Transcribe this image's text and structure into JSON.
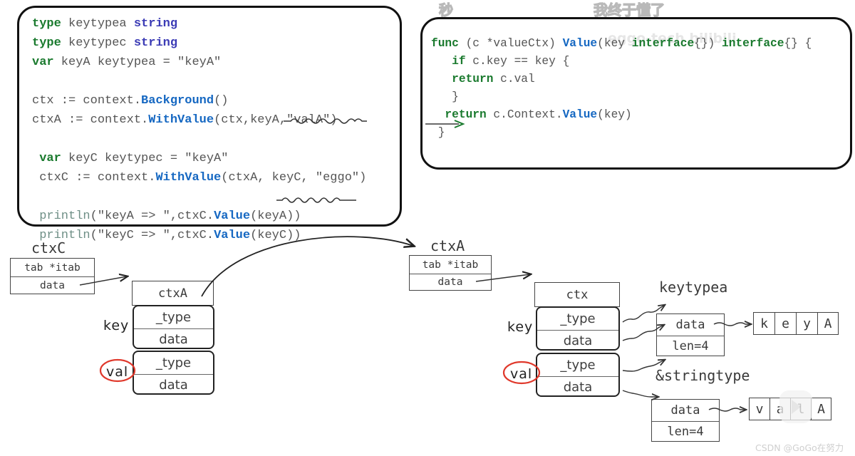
{
  "page": {
    "title": "Go context.WithValue chain memory layout diagram",
    "background": "#ffffff"
  },
  "colors": {
    "keyword_green": "#1a7a2e",
    "type_blue": "#3b3bb5",
    "func_blue": "#1668c2",
    "println_teal": "#6e8f86",
    "code_gray": "#555555",
    "ink_black": "#222222",
    "accent_red": "#e0392c",
    "watermark_gray": "#cfcfcf"
  },
  "top_watermarks": {
    "left_text": "秒",
    "right_text": "我终于懂了"
  },
  "code_left": {
    "lines": [
      [
        {
          "t": "type",
          "c": "kw"
        },
        {
          "t": " keytypea ",
          "c": "pn"
        },
        {
          "t": "string",
          "c": "ty"
        }
      ],
      [
        {
          "t": "type",
          "c": "kw"
        },
        {
          "t": " keytypec ",
          "c": "pn"
        },
        {
          "t": "string",
          "c": "ty"
        }
      ],
      [
        {
          "t": "var",
          "c": "kw"
        },
        {
          "t": " keyA keytypea = \"keyA\"",
          "c": "pn"
        }
      ],
      [
        {
          "t": "",
          "c": "pn"
        }
      ],
      [
        {
          "t": "ctx := context.",
          "c": "pn"
        },
        {
          "t": "Background",
          "c": "fn"
        },
        {
          "t": "()",
          "c": "pn"
        }
      ],
      [
        {
          "t": "ctxA := context.",
          "c": "pn"
        },
        {
          "t": "WithValue",
          "c": "fn"
        },
        {
          "t": "(ctx,keyA,\"valA\")",
          "c": "pn"
        }
      ],
      [
        {
          "t": "",
          "c": "pn"
        }
      ],
      [
        {
          "t": " var",
          "c": "kw"
        },
        {
          "t": " keyC keytypec = \"keyA\"",
          "c": "pn"
        }
      ],
      [
        {
          "t": " ctxC := context.",
          "c": "pn"
        },
        {
          "t": "WithValue",
          "c": "fn"
        },
        {
          "t": "(ctxA, keyC, \"eggo\")",
          "c": "pn"
        }
      ],
      [
        {
          "t": "",
          "c": "pn"
        }
      ],
      [
        {
          "t": " println",
          "c": "pl"
        },
        {
          "t": "(\"keyA => \",ctxC.",
          "c": "pn"
        },
        {
          "t": "Value",
          "c": "fn"
        },
        {
          "t": "(keyA))",
          "c": "pn"
        }
      ],
      [
        {
          "t": " println",
          "c": "pl"
        },
        {
          "t": "(\"keyC => \",ctxC.",
          "c": "pn"
        },
        {
          "t": "Value",
          "c": "fn"
        },
        {
          "t": "(keyC))",
          "c": "pn"
        }
      ]
    ]
  },
  "code_right": {
    "watermark": "eggo-tech bilibili",
    "lines": [
      [
        {
          "t": "func",
          "c": "kw"
        },
        {
          "t": " (c *valueCtx) ",
          "c": "pn"
        },
        {
          "t": "Value",
          "c": "fn"
        },
        {
          "t": "(key ",
          "c": "pn"
        },
        {
          "t": "interface",
          "c": "kw"
        },
        {
          "t": "{}) ",
          "c": "pn"
        },
        {
          "t": "interface",
          "c": "kw"
        },
        {
          "t": "{} {",
          "c": "pn"
        }
      ],
      [
        {
          "t": "   if",
          "c": "kw"
        },
        {
          "t": " c.key == key {",
          "c": "pn"
        }
      ],
      [
        {
          "t": "   return",
          "c": "kw"
        },
        {
          "t": " c.val",
          "c": "pn"
        }
      ],
      [
        {
          "t": "   }",
          "c": "pn"
        }
      ],
      [
        {
          "t": "  return",
          "c": "kw"
        },
        {
          "t": " c.Context.",
          "c": "pn"
        },
        {
          "t": "Value",
          "c": "fn"
        },
        {
          "t": "(key)",
          "c": "pn"
        }
      ],
      [
        {
          "t": " }",
          "c": "pn"
        }
      ]
    ]
  },
  "diagram": {
    "ctxc_iface": {
      "title": "ctxC",
      "rows": [
        "tab *itab",
        "data"
      ]
    },
    "ctxa_struct": {
      "header": "ctxA",
      "key_label": "key",
      "val_label": "val",
      "key_rows": [
        "_type",
        "data"
      ],
      "val_rows": [
        "_type",
        "data"
      ]
    },
    "ctxa_iface": {
      "title": "ctxA",
      "rows": [
        "tab *itab",
        "data"
      ]
    },
    "ctx_struct": {
      "header": "ctx",
      "key_label": "key",
      "val_label": "val",
      "key_rows": [
        "_type",
        "data"
      ],
      "val_rows": [
        "_type",
        "data"
      ]
    },
    "key_type_name": "keytypea",
    "key_string_header": {
      "rows": [
        "data",
        "len=4"
      ],
      "chars": [
        "k",
        "e",
        "y",
        "A"
      ]
    },
    "val_type_name": "&stringtype",
    "val_string_header": {
      "rows": [
        "data",
        "len=4"
      ],
      "chars": [
        "v",
        "a",
        "l",
        "A"
      ]
    }
  },
  "footer_watermark": "CSDN @GoGo在努力"
}
